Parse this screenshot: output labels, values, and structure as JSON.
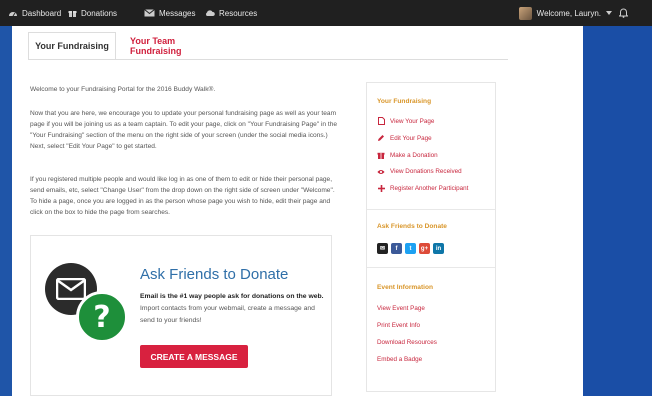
{
  "nav": {
    "items": [
      {
        "label": "Dashboard",
        "icon": "dashboard-icon"
      },
      {
        "label": "Donations",
        "icon": "gift-icon"
      },
      {
        "label": "Messages",
        "icon": "envelope-icon"
      },
      {
        "label": "Resources",
        "icon": "cloud-icon"
      }
    ],
    "welcome": "Welcome, Lauryn."
  },
  "tabs": {
    "active": "Your Fundraising",
    "inactive": "Your Team Fundraising"
  },
  "intro": {
    "p1": "Welcome to your Fundraising Portal for the 2016 Buddy Walk®.",
    "p2": "Now that you are here, we encourage you to update your personal fundraising page as well as your team page if you will be joining us as a team captain.  To edit your page, click on \"Your Fundraising Page\" in the \"Your Fundraising\" section of the menu on the right side of your screen (under the social media icons.)  Next, select \"Edit Your Page\" to get started.",
    "p3": "If you registered multiple people and would like log in as one of them to edit or hide their personal page, send emails, etc, select \"Change User\" from the drop down on the right side of screen under \"Welcome\".  To hide a page, once you are logged in as the person whose page you wish to hide, edit their page and click on the box to hide the page from searches."
  },
  "ask": {
    "title": "Ask Friends to Donate",
    "desc_bold": "Email is the #1 way people ask for donations on the web.",
    "desc_rest": " Import contacts from your webmail, create a message and send to your friends!",
    "cta": "CREATE A MESSAGE"
  },
  "sidebar": {
    "fundraising_title": "Your Fundraising",
    "fundraising_links": [
      {
        "label": "View Your Page",
        "icon": "page-icon"
      },
      {
        "label": "Edit Your Page",
        "icon": "pencil-icon"
      },
      {
        "label": "Make a Donation",
        "icon": "gift-icon"
      },
      {
        "label": "View Donations Received",
        "icon": "eye-icon"
      },
      {
        "label": "Register Another Participant",
        "icon": "plus-icon"
      }
    ],
    "ask_title": "Ask Friends to Donate",
    "social": [
      {
        "label": "✉",
        "icon": "email-icon",
        "color": "#222222"
      },
      {
        "label": "f",
        "icon": "facebook-icon",
        "color": "#3b5998"
      },
      {
        "label": "t",
        "icon": "twitter-icon",
        "color": "#1da1f2"
      },
      {
        "label": "g+",
        "icon": "google-plus-icon",
        "color": "#dd4b39"
      },
      {
        "label": "in",
        "icon": "linkedin-icon",
        "color": "#0e76a8"
      }
    ],
    "event_title": "Event Information",
    "event_links": [
      "View Event Page",
      "Print Event Info",
      "Download Resources",
      "Embed a Badge"
    ]
  },
  "colors": {
    "accent_red": "#d8213f",
    "heading_gold": "#d9962a",
    "brand_blue": "#1d4fa0"
  }
}
